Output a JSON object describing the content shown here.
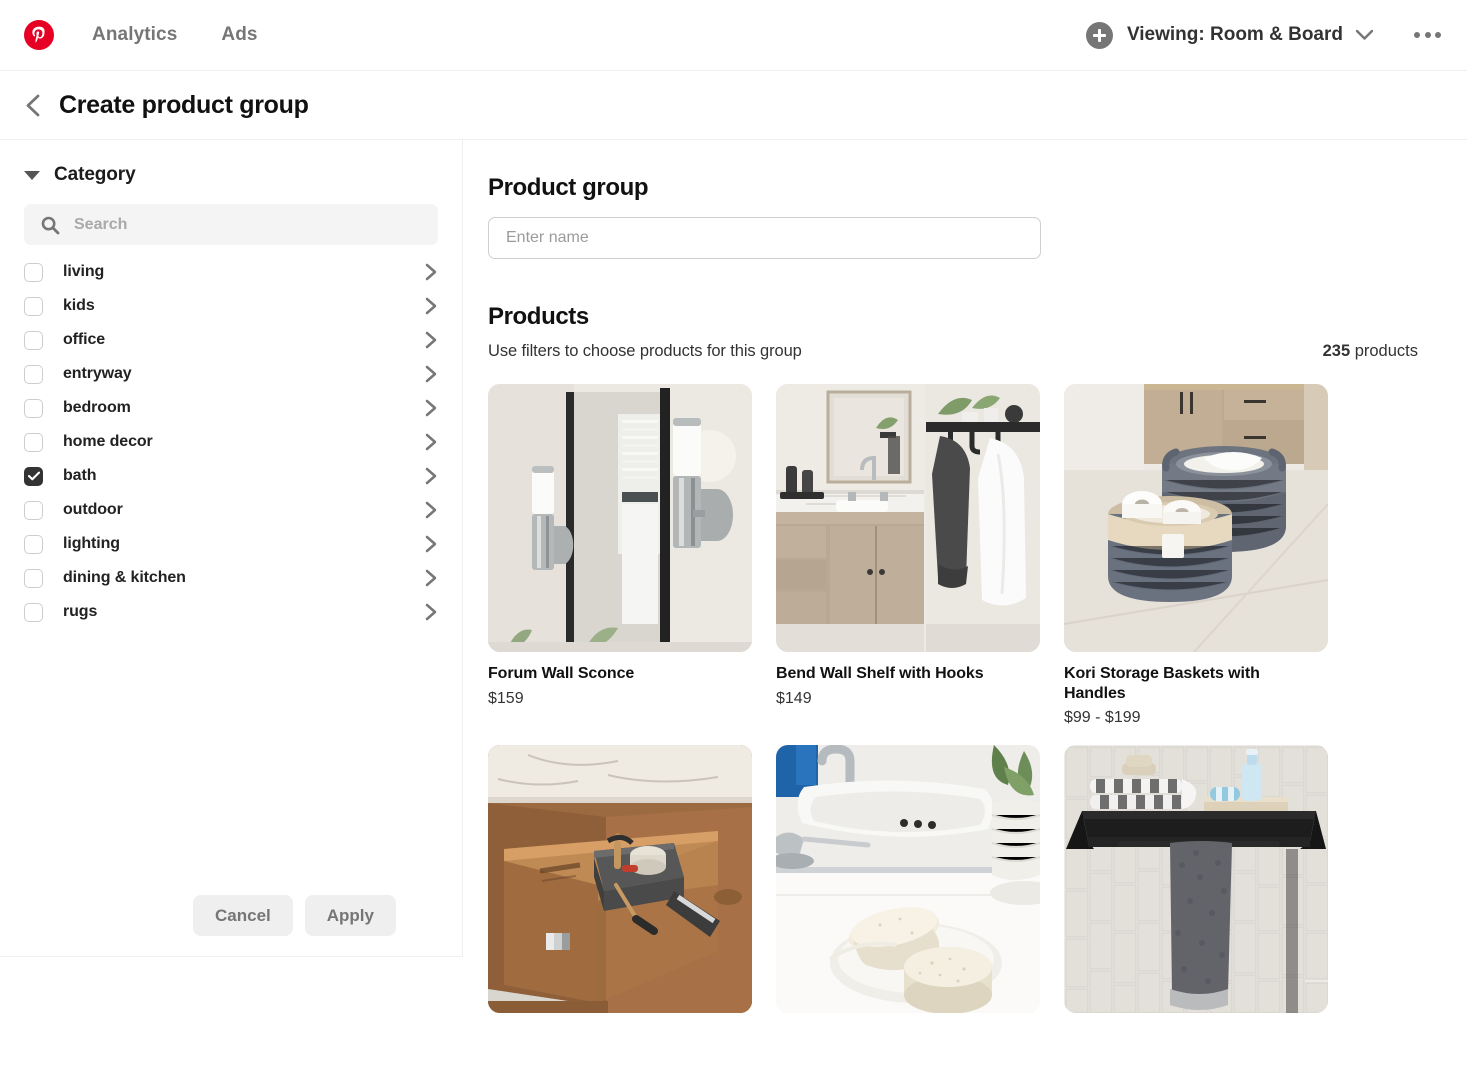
{
  "topnav": {
    "logo_icon": "pinterest-logo-icon",
    "links": [
      {
        "label": "Analytics"
      },
      {
        "label": "Ads"
      }
    ],
    "add_icon": "plus-circle-icon",
    "viewing_label": "Viewing: Room & Board",
    "chevron_icon": "chevron-down-icon",
    "more_icon": "more-options-icon"
  },
  "subheader": {
    "back_icon": "chevron-left-icon",
    "title": "Create product group"
  },
  "filters": {
    "section_title": "Category",
    "collapse_icon": "triangle-down-icon",
    "search": {
      "icon": "search-icon",
      "placeholder": "Search",
      "value": ""
    },
    "categories": [
      {
        "label": "living",
        "checked": false
      },
      {
        "label": "kids",
        "checked": false
      },
      {
        "label": "office",
        "checked": false
      },
      {
        "label": "entryway",
        "checked": false
      },
      {
        "label": "bedroom",
        "checked": false
      },
      {
        "label": "home decor",
        "checked": false
      },
      {
        "label": "bath",
        "checked": true
      },
      {
        "label": "outdoor",
        "checked": false
      },
      {
        "label": "lighting",
        "checked": false
      },
      {
        "label": "dining & kitchen",
        "checked": false
      },
      {
        "label": "rugs",
        "checked": false
      }
    ],
    "cancel_label": "Cancel",
    "apply_label": "Apply"
  },
  "main": {
    "group_heading": "Product group",
    "name_placeholder": "Enter name",
    "name_value": "",
    "products_heading": "Products",
    "products_subtitle": "Use filters to choose products for this group",
    "products_count": "235",
    "products_count_suffix": " products",
    "products": [
      {
        "title": "Forum Wall Sconce",
        "price": "$159",
        "image": "bathroom-wall-sconce-mirror-photo"
      },
      {
        "title": "Bend Wall Shelf with Hooks",
        "price": "$149",
        "image": "bathroom-vanity-wall-hooks-robes-photo"
      },
      {
        "title": "Kori Storage Baskets with Handles",
        "price": "$99 - $199",
        "image": "woven-storage-baskets-photo"
      },
      {
        "title": "",
        "price": "",
        "image": "walnut-vanity-drawer-organizer-photo"
      },
      {
        "title": "",
        "price": "",
        "image": "soap-bars-sink-tray-photo"
      },
      {
        "title": "",
        "price": "",
        "image": "black-shelf-towel-bar-tile-photo"
      }
    ]
  },
  "colors": {
    "brand_red": "#e60023",
    "text_dark": "#111111",
    "text_muted": "#767676",
    "border": "#efefef",
    "checkbox_checked": "#333333"
  }
}
